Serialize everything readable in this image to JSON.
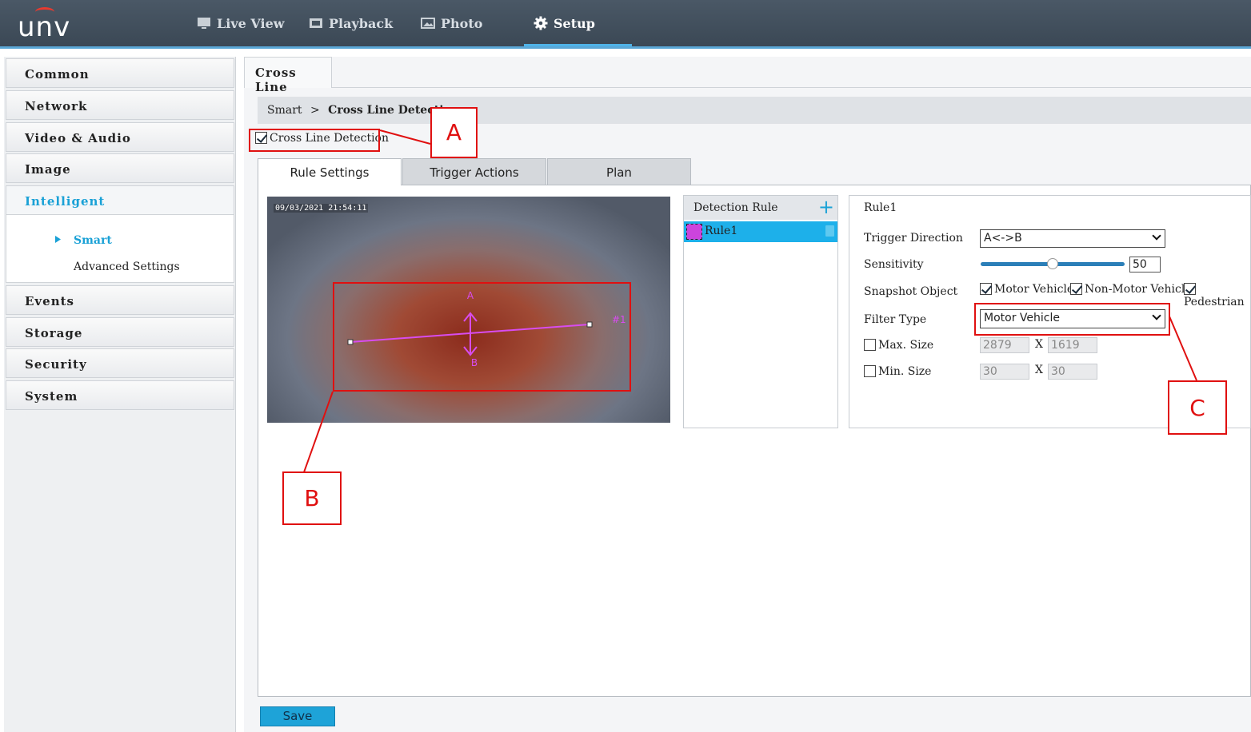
{
  "brand": {
    "logo_text": "unv",
    "accent": "#e83a2f",
    "highlight": "#1aa1d6"
  },
  "nav": [
    {
      "label": "Live View",
      "icon": "monitor-icon"
    },
    {
      "label": "Playback",
      "icon": "film-icon"
    },
    {
      "label": "Photo",
      "icon": "photo-icon"
    },
    {
      "label": "Setup",
      "icon": "gear-icon",
      "active": true
    }
  ],
  "sidebar": {
    "items": [
      "Common",
      "Network",
      "Video & Audio",
      "Image",
      "Intelligent",
      "Events",
      "Storage",
      "Security",
      "System"
    ],
    "active": "Intelligent",
    "sub_items": [
      "Smart",
      "Advanced Settings"
    ],
    "active_sub": "Smart"
  },
  "page": {
    "tab": "Cross Line",
    "breadcrumb_parent": "Smart",
    "breadcrumb_sep": ">",
    "breadcrumb_current": "Cross Line Detection",
    "enable_label": "Cross Line Detection",
    "enable_checked": true
  },
  "tabs": [
    "Rule Settings",
    "Trigger Actions",
    "Plan"
  ],
  "active_tab": "Rule Settings",
  "video": {
    "timestamp": "09/03/2021 21:54:11",
    "arrow_label_a": "A",
    "arrow_label_b": "B",
    "line_tag": "#1"
  },
  "rules": {
    "header": "Detection Rule",
    "add_icon": "plus-icon",
    "items": [
      {
        "name": "Rule1",
        "color": "#cc44dd",
        "delete_icon": "trash-icon"
      }
    ]
  },
  "form": {
    "rule_name": "Rule1",
    "trigger_direction_label": "Trigger Direction",
    "trigger_direction_value": "A<->B",
    "sensitivity_label": "Sensitivity",
    "sensitivity_value": "50",
    "snapshot_label": "Snapshot Object",
    "snapshot_options": [
      {
        "label": "Motor Vehicle",
        "checked": true
      },
      {
        "label": "Non-Motor Vehicle",
        "checked": true
      },
      {
        "label": "Pedestrian",
        "checked": true
      }
    ],
    "filter_type_label": "Filter Type",
    "filter_type_value": "Motor Vehicle",
    "max_size_label": "Max. Size",
    "max_size_w": "2879",
    "max_size_h": "1619",
    "min_size_label": "Min. Size",
    "min_size_w": "30",
    "min_size_h": "30",
    "x_sep": "X"
  },
  "save_label": "Save",
  "annotations": [
    "A",
    "B",
    "C"
  ]
}
